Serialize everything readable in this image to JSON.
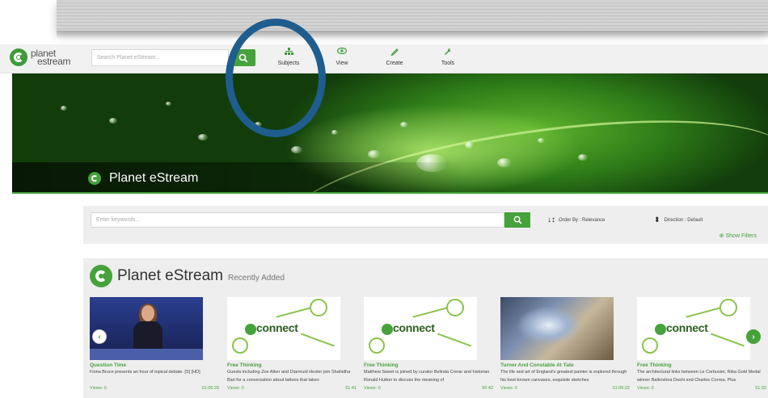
{
  "header": {
    "logo_line1": "planet",
    "logo_line2": "estream",
    "search_placeholder": "Search Planet eStream...",
    "nav": [
      {
        "label": "Subjects",
        "icon": "sitemap-icon"
      },
      {
        "label": "View",
        "icon": "eye-icon"
      },
      {
        "label": "Create",
        "icon": "pencil-icon"
      },
      {
        "label": "Tools",
        "icon": "wrench-icon"
      }
    ]
  },
  "hero": {
    "title": "Planet eStream"
  },
  "filter": {
    "keywords_placeholder": "Enter keywords...",
    "order_by": "Order By : Relevance",
    "direction": "Direction : Default",
    "show_filters": "Show Filters"
  },
  "recent": {
    "brand": "Planet eStream",
    "subtitle": "Recently Added",
    "items": [
      {
        "title": "Question Time",
        "desc": "Fiona Bruce presents an hour of topical debate. [S] [HD]",
        "views": "Views: 0",
        "duration": "01:06:29",
        "thumb": "question-time"
      },
      {
        "title": "Free Thinking",
        "desc": "Guests including Zoe Alker and Diarmuid Hester join Shahidha Bari for a conversation about tattoos that takes",
        "views": "Views: 0",
        "duration": "51:41",
        "thumb": "connect"
      },
      {
        "title": "Free Thinking",
        "desc": "Matthew Sweet is joined by curator Belinda Crerar and historian Ronald Hutton to discuss the meaning of",
        "views": "Views: 0",
        "duration": "50:42",
        "thumb": "connect"
      },
      {
        "title": "Turner And Constable At Tate",
        "desc": "The life and art of England's greatest painter is explored through his best-known canvases, exquisite sketches",
        "views": "Views: 0",
        "duration": "01:06:22",
        "thumb": "turner"
      },
      {
        "title": "Free Thinking",
        "desc": "The architectural links between Le Corbusier, Riba Gold Medal winner Balkrishna Doshi and Charles Correa. Plus",
        "views": "Views: 0",
        "duration": "51:32",
        "thumb": "connect"
      }
    ],
    "connect_word": "connect"
  },
  "colors": {
    "accent": "#46a23b",
    "annotation_circle": "#1f5d8e"
  }
}
